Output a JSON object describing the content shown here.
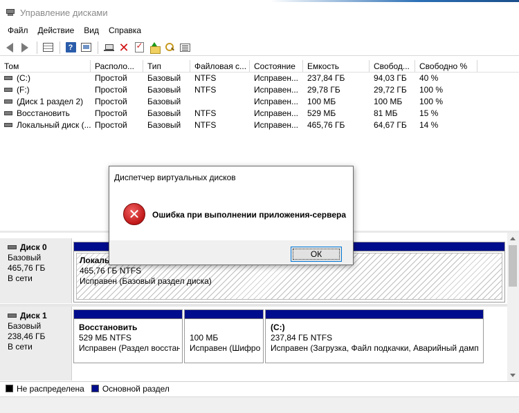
{
  "window": {
    "title": "Управление дисками"
  },
  "menu": [
    "Файл",
    "Действие",
    "Вид",
    "Справка"
  ],
  "toolbar": {
    "icons": [
      "back-arrow-icon",
      "forward-arrow-icon",
      "list-view-icon",
      "help-icon",
      "panel-view-icon",
      "connect-drive-icon",
      "delete-icon",
      "check-disk-icon",
      "open-folder-icon",
      "find-icon",
      "properties-icon"
    ],
    "help_glyph": "?",
    "delete_glyph": "✕"
  },
  "volume_table": {
    "columns": [
      "Том",
      "Располо...",
      "Тип",
      "Файловая с...",
      "Состояние",
      "Емкость",
      "Свобод...",
      "Свободно %"
    ],
    "rows": [
      [
        "(C:)",
        "Простой",
        "Базовый",
        "NTFS",
        "Исправен...",
        "237,84 ГБ",
        "94,03 ГБ",
        "40 %"
      ],
      [
        "(F:)",
        "Простой",
        "Базовый",
        "NTFS",
        "Исправен...",
        "29,78 ГБ",
        "29,72 ГБ",
        "100 %"
      ],
      [
        "(Диск 1 раздел 2)",
        "Простой",
        "Базовый",
        "",
        "Исправен...",
        "100 МБ",
        "100 МБ",
        "100 %"
      ],
      [
        "Восстановить",
        "Простой",
        "Базовый",
        "NTFS",
        "Исправен...",
        "529 МБ",
        "81 МБ",
        "15 %"
      ],
      [
        "Локальный диск (...",
        "Простой",
        "Базовый",
        "NTFS",
        "Исправен...",
        "465,76 ГБ",
        "64,67 ГБ",
        "14 %"
      ]
    ]
  },
  "disks": [
    {
      "name": "Диск 0",
      "type": "Базовый",
      "size": "465,76 ГБ",
      "status": "В сети",
      "partitions": [
        {
          "name": "Локаль",
          "size_fs": "465,76 ГБ NTFS",
          "state": "Исправен (Базовый раздел диска)"
        }
      ]
    },
    {
      "name": "Диск 1",
      "type": "Базовый",
      "size": "238,46 ГБ",
      "status": "В сети",
      "partitions": [
        {
          "name": "Восстановить",
          "size_fs": "529 МБ NTFS",
          "state": "Исправен (Раздел восстан"
        },
        {
          "name": "",
          "size_fs": "100 МБ",
          "state": "Исправен (Шифро"
        },
        {
          "name": "(C:)",
          "size_fs": "237,84 ГБ NTFS",
          "state": "Исправен (Загрузка, Файл подкачки, Аварийный дамп"
        }
      ]
    }
  ],
  "legend": [
    {
      "label": "Не распределена",
      "color": "#000000"
    },
    {
      "label": "Основной раздел",
      "color": "#000d8c"
    }
  ],
  "dialog": {
    "title": "Диспетчер виртуальных дисков",
    "icon": "error-icon",
    "icon_glyph": "✕",
    "message": "Ошибка при выполнении приложения-сервера",
    "ok_label": "ОК"
  }
}
